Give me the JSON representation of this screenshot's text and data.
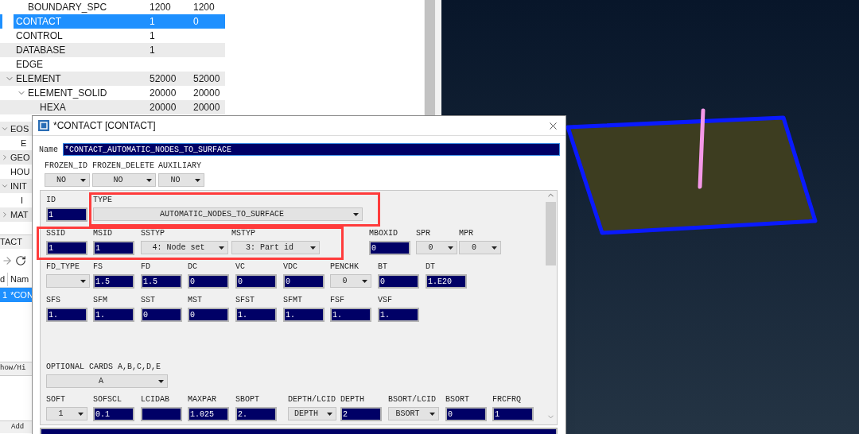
{
  "tree": {
    "items": [
      {
        "children": [
          {
            "label": "BOUNDARY_SPC",
            "count": "1200",
            "count_2": "1200",
            "selected": false
          }
        ]
      },
      {
        "label": "CONTACT",
        "count": "1",
        "count_2": "0",
        "selected": true
      },
      {
        "label": "CONTROL",
        "count": "1",
        "selected": false
      },
      {
        "label": "DATABASE",
        "count": "1",
        "selected": false
      },
      {
        "label": "EDGE",
        "selected": false
      },
      {
        "label": "ELEMENT",
        "count": "52000",
        "count_2": "52000",
        "selected": false,
        "expanded": true,
        "children": [
          {
            "label": "ELEMENT_SOLID",
            "count": "20000",
            "count_2": "20000",
            "selected": false,
            "expanded": true,
            "children": [
              {
                "label": "HEXA",
                "count": "20000",
                "count_2": "20000",
                "selected": false
              }
            ]
          }
        ]
      }
    ]
  },
  "tree_continued": [
    {
      "label": "EOS",
      "expanded": true,
      "children": [
        {
          "label": "E"
        }
      ]
    },
    {
      "label": "GEO",
      "expanded": false
    },
    {
      "label": "HOU"
    },
    {
      "label": "INIT",
      "expanded": true,
      "children": [
        {
          "label": "I"
        }
      ]
    },
    {
      "label": "MAT",
      "expanded": false
    }
  ],
  "keyword_panel": {
    "title": "TACT",
    "table": {
      "columns": [
        "d",
        "Nam"
      ],
      "rows": [
        {
          "cells": [
            "1",
            "*CON"
          ],
          "selected": true
        }
      ]
    },
    "buttons": [
      "how/Hi",
      "Add"
    ]
  },
  "dialog": {
    "title": "*CONTACT [CONTACT]",
    "name": {
      "label": "Name",
      "value": "*CONTACT_AUTOMATIC_NODES_TO_SURFACE"
    },
    "flags": [
      {
        "label": "FROZEN_ID",
        "value": "NO"
      },
      {
        "label": "FROZEN_DELETE",
        "value": "NO"
      },
      {
        "label": "AUXILIARY",
        "value": "NO"
      }
    ],
    "card_rows": [
      {
        "fields": [
          {
            "label": "ID",
            "kind": "input",
            "value": "1"
          },
          {
            "label": "TYPE",
            "kind": "select",
            "value": "AUTOMATIC_NODES_TO_SURFACE"
          }
        ]
      },
      {
        "fields": [
          {
            "label": "SSID",
            "kind": "input",
            "value": "1"
          },
          {
            "label": "MSID",
            "kind": "input",
            "value": "1"
          },
          {
            "label": "SSTYP",
            "kind": "select",
            "value": "4: Node set"
          },
          {
            "label": "MSTYP",
            "kind": "select",
            "value": "3: Part id"
          },
          {
            "label": "MBOXID",
            "kind": "input",
            "value": "0"
          },
          {
            "label": "SPR",
            "kind": "select",
            "value": "0"
          },
          {
            "label": "MPR",
            "kind": "select",
            "value": "0"
          }
        ]
      },
      {
        "fields": [
          {
            "label": "FD_TYPE",
            "kind": "select"
          },
          {
            "label": "FS",
            "kind": "input",
            "value": "1.5"
          },
          {
            "label": "FD",
            "kind": "input",
            "value": "1.5"
          },
          {
            "label": "DC",
            "kind": "input",
            "value": "0"
          },
          {
            "label": "VC",
            "kind": "input",
            "value": "0"
          },
          {
            "label": "VDC",
            "kind": "input",
            "value": "0"
          },
          {
            "label": "PENCHK",
            "kind": "select",
            "value": "0"
          },
          {
            "label": "BT",
            "kind": "input",
            "value": "0"
          },
          {
            "label": "DT",
            "kind": "input",
            "value": "1.E20"
          }
        ]
      },
      {
        "fields": [
          {
            "label": "SFS",
            "kind": "input",
            "value": "1."
          },
          {
            "label": "SFM",
            "kind": "input",
            "value": "1."
          },
          {
            "label": "SST",
            "kind": "input",
            "value": "0"
          },
          {
            "label": "MST",
            "kind": "input",
            "value": "0"
          },
          {
            "label": "SFST",
            "kind": "input",
            "value": "1."
          },
          {
            "label": "SFMT",
            "kind": "input",
            "value": "1."
          },
          {
            "label": "FSF",
            "kind": "input",
            "value": "1."
          },
          {
            "label": "VSF",
            "kind": "input",
            "value": "1."
          }
        ]
      }
    ],
    "optional": {
      "label": "OPTIONAL CARDS A,B,C,D,E",
      "value": "A"
    },
    "optional_row": {
      "fields": [
        {
          "label": "SOFT",
          "kind": "select",
          "value": "1"
        },
        {
          "label": "SOFSCL",
          "kind": "input",
          "value": "0.1"
        },
        {
          "label": "LCIDAB",
          "kind": "input"
        },
        {
          "label": "MAXPAR",
          "kind": "input",
          "value": "1.025"
        },
        {
          "label": "SBOPT",
          "kind": "input",
          "value": "2."
        },
        {
          "label": "DEPTH/LCID",
          "kind": "select",
          "value": "DEPTH"
        },
        {
          "label": "DEPTH",
          "kind": "input",
          "value": "2"
        },
        {
          "label": "BSORT/LCID",
          "kind": "select",
          "value": "BSORT"
        },
        {
          "label": "BSORT",
          "kind": "input",
          "value": "0"
        },
        {
          "label": "FRCFRQ",
          "kind": "input",
          "value": "1"
        }
      ]
    }
  }
}
